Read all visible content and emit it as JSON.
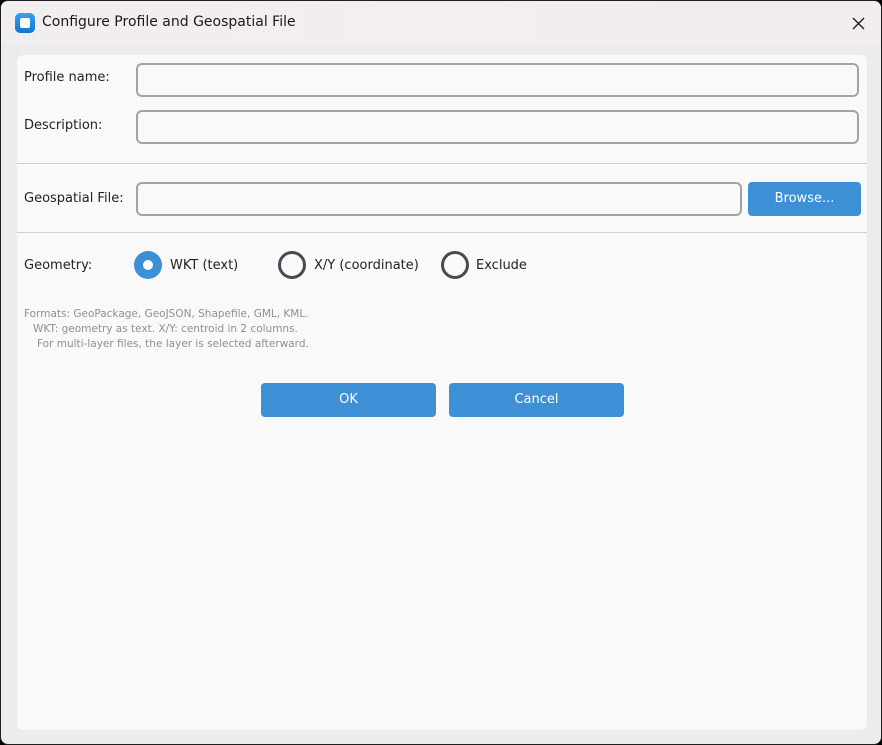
{
  "window": {
    "title": "Configure Profile and Geospatial File"
  },
  "form": {
    "profile_name": {
      "label": "Profile name:",
      "value": ""
    },
    "description": {
      "label": "Description:",
      "value": ""
    },
    "geospatial_file": {
      "label": "Geospatial File:",
      "value": "",
      "browse_label": "Browse..."
    },
    "geometry": {
      "label": "Geometry:",
      "options": [
        {
          "label": "WKT (text)",
          "selected": true
        },
        {
          "label": "X/Y (coordinate)",
          "selected": false
        },
        {
          "label": "Exclude",
          "selected": false
        }
      ]
    },
    "help_lines": [
      "Formats: GeoPackage, GeoJSON, Shapefile, GML, KML.",
      "WKT: geometry as text. X/Y: centroid in 2 columns.",
      "For multi-layer files, the layer is selected afterward."
    ]
  },
  "buttons": {
    "ok": "OK",
    "cancel": "Cancel"
  },
  "colors": {
    "accent": "#3d8fd6",
    "panel": "#f9f9f9",
    "window": "#ececec"
  },
  "icons": {
    "app": "app-icon",
    "close": "close-icon"
  }
}
